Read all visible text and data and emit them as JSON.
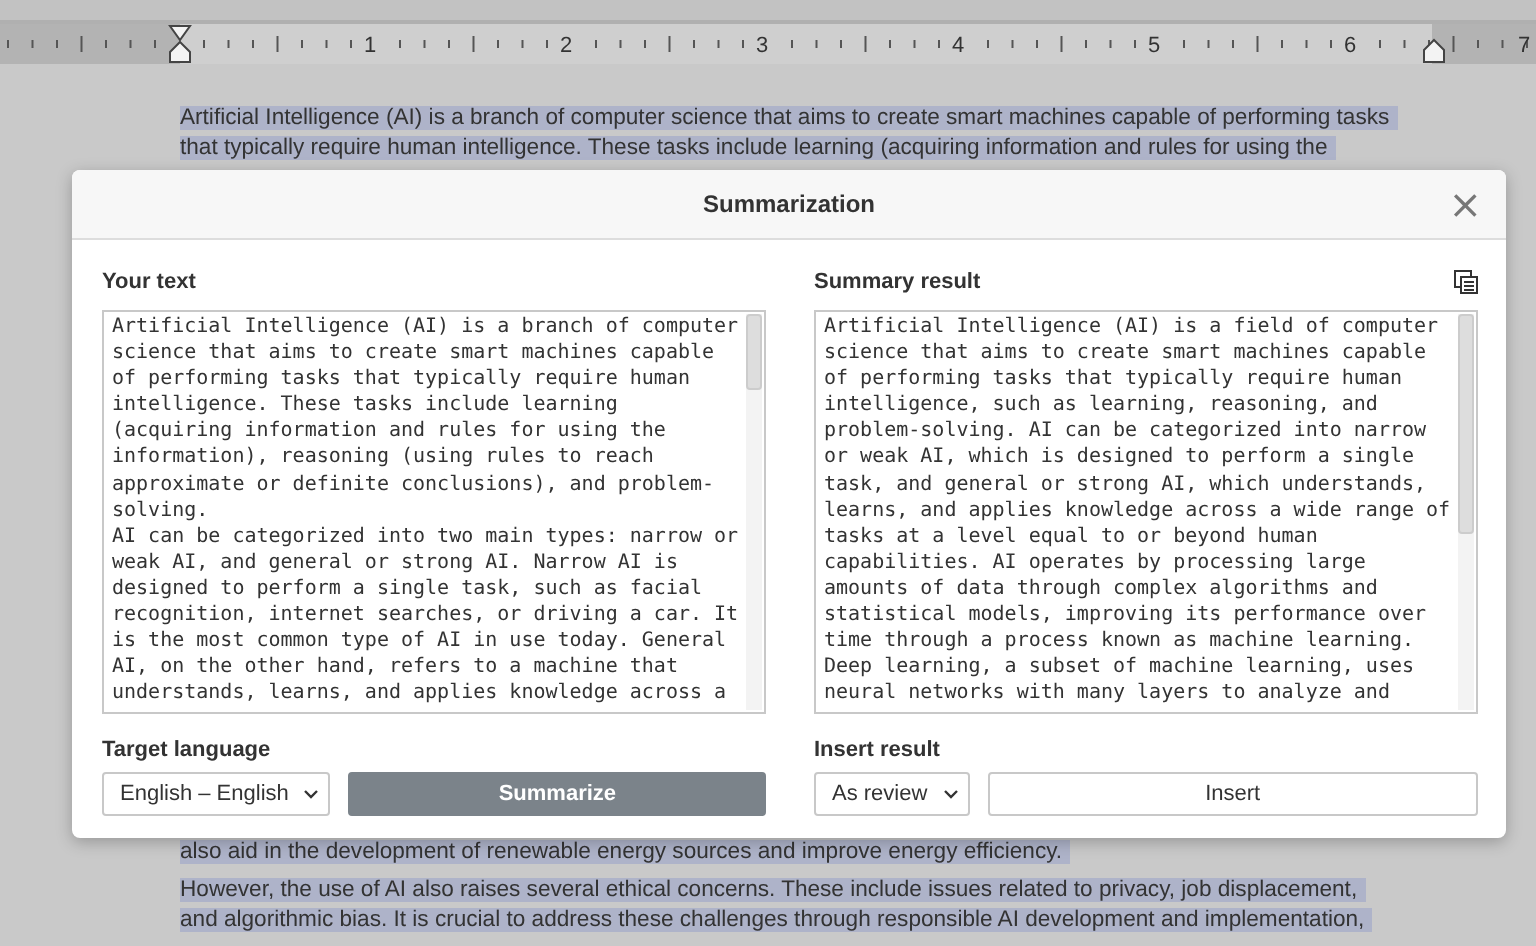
{
  "ruler": {
    "numbers": [
      "1",
      "2",
      "3",
      "4",
      "5",
      "6",
      "7"
    ]
  },
  "document": {
    "paragraphs_above": [
      {
        "selected": true,
        "lines": [
          "Artificial Intelligence (AI) is a branch of computer science that aims to create smart machines capable of performing tasks",
          "that typically require human intelligence. These tasks include learning (acquiring information and rules for using the"
        ]
      }
    ],
    "paragraphs_below": [
      {
        "selected": true,
        "lines": [
          "also aid in the development of renewable energy sources and improve energy efficiency."
        ]
      },
      {
        "selected": true,
        "lines": [
          "However, the use of AI also raises several ethical concerns. These include issues related to privacy, job displacement,",
          "and algorithmic bias. It is crucial to address these challenges through responsible AI development and implementation,"
        ]
      }
    ]
  },
  "dialog": {
    "title": "Summarization",
    "close": "×",
    "your_text": {
      "label": "Your text",
      "paragraphs": [
        "Artificial Intelligence (AI) is a branch of computer science that aims to create smart machines capable of performing tasks that typically require human intelligence. These tasks include learning (acquiring information and rules for using the information), reasoning (using rules to reach approximate or definite conclusions), and problem-solving.",
        "AI can be categorized into two main types: narrow or weak AI, and general or strong AI. Narrow AI is designed to perform a single task, such as facial recognition, internet searches, or driving a car. It is the most common type of AI in use today. General AI, on the other hand, refers to a machine that understands, learns, and applies knowledge across a"
      ]
    },
    "summary_result": {
      "label": "Summary result",
      "paragraphs": [
        "Artificial Intelligence (AI) is a field of computer science that aims to create smart machines capable of performing tasks that typically require human intelligence, such as learning, reasoning, and problem-solving. AI can be categorized into narrow or weak AI, which is designed to perform a single task, and general or strong AI, which understands, learns, and applies knowledge across a wide range of tasks at a level equal to or beyond human capabilities. AI operates by processing large amounts of data through complex algorithms and statistical models, improving its performance over time through a process known as machine learning. Deep learning, a subset of machine learning, uses neural networks with many layers to analyze and"
      ]
    },
    "target_language": {
      "label": "Target language",
      "value": "English – English"
    },
    "summarize_button": "Summarize",
    "insert_result": {
      "label": "Insert result",
      "value": "As review"
    },
    "insert_button": "Insert"
  }
}
